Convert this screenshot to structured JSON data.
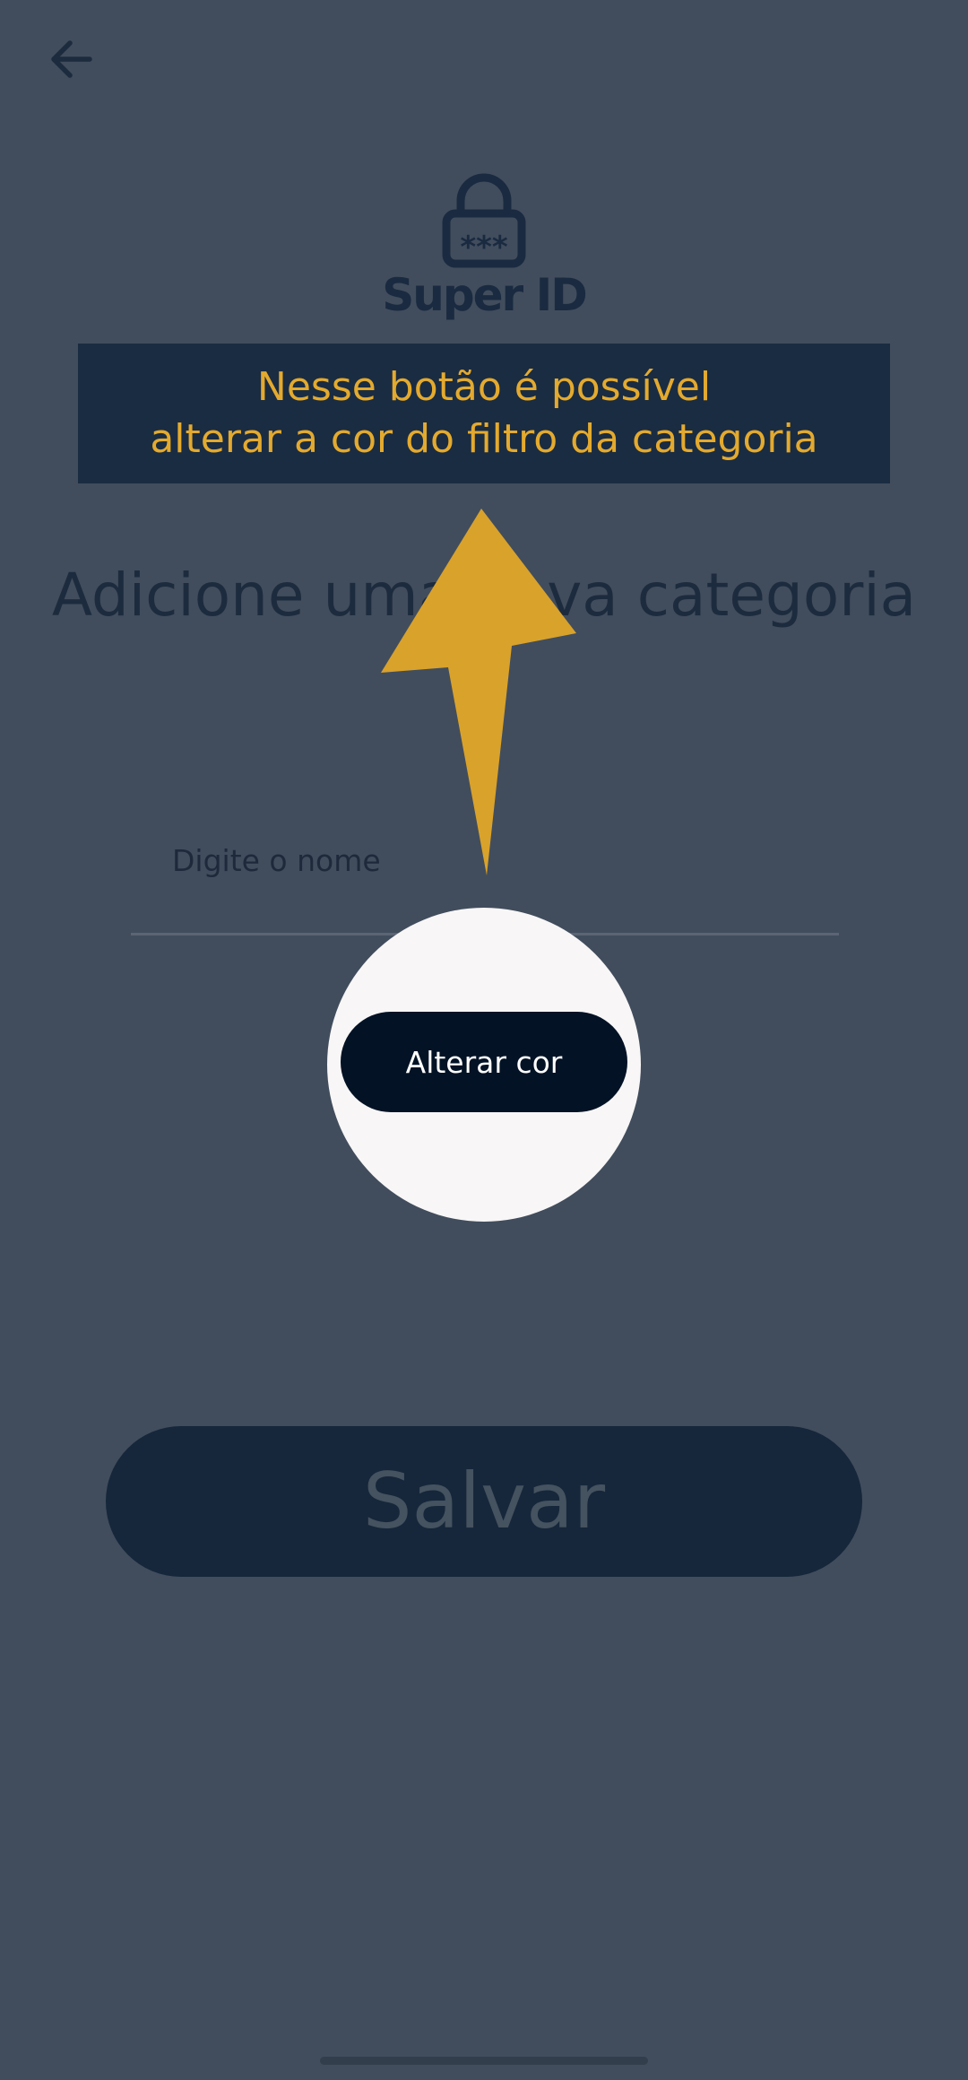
{
  "header": {
    "back_icon": "arrow-left-icon"
  },
  "logo": {
    "icon": "lock-icon",
    "lock_text": "***",
    "text": "Super ID"
  },
  "tooltip": {
    "line1": "Nesse botão é possível",
    "line2": "alterar a cor do filtro da categoria",
    "color": "#e4aa2e"
  },
  "main": {
    "title": "Adicione uma nova categoria",
    "name_field": {
      "placeholder": "Digite o nome",
      "value": ""
    },
    "change_color_button": "Alterar cor",
    "save_button": "Salvar"
  },
  "colors": {
    "background": "#414d5d",
    "accent": "#e4aa2e",
    "button_dark": "#031225"
  }
}
